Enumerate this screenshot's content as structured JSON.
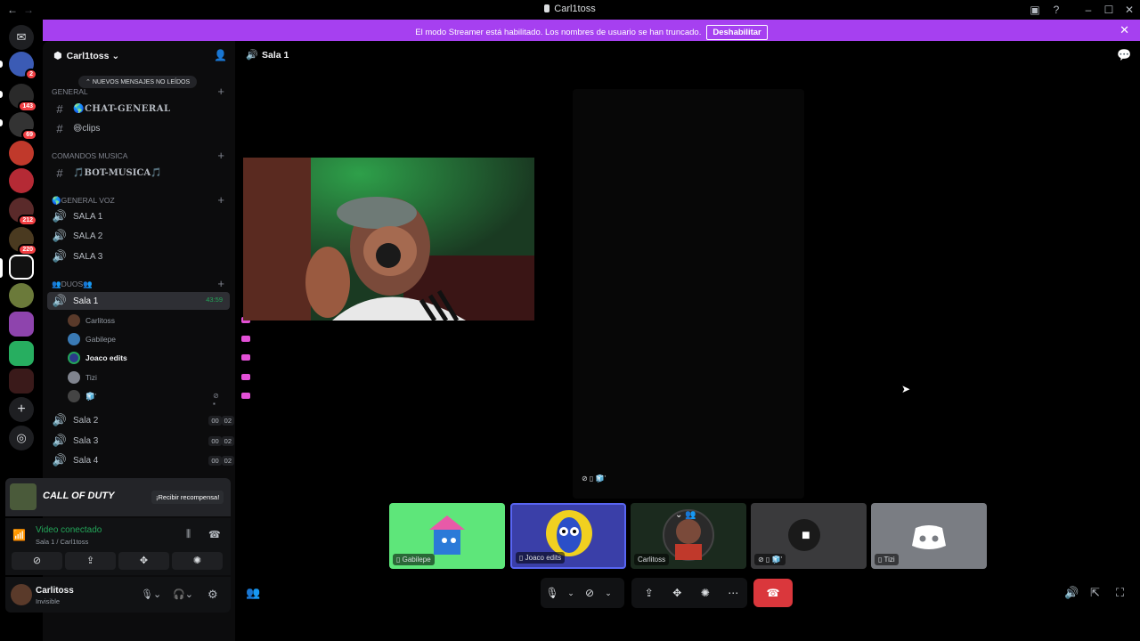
{
  "window": {
    "title": "Carl1toss"
  },
  "banner": {
    "text": "El modo Streamer está habilitado. Los nombres de usuario se han truncado.",
    "button": "Deshabilitar",
    "color": "#a640f0"
  },
  "rail": {
    "badges": [
      "2",
      "143",
      "69",
      "212",
      "220"
    ]
  },
  "sidebar": {
    "guild_name": "Carl1toss",
    "unread_pill": "NUEVOS MENSAJES NO LEÍDOS",
    "cat_general": "GENERAL",
    "ch_chat": "🌎CHAT-GENERAL",
    "ch_clips": "😄clips",
    "cat_musica": "COMANDOS MUSICA",
    "ch_bot": "🎵BOT-MUSICA🎵",
    "cat_voz": "🌎GENERAL VOZ",
    "voz": [
      "SALA 1",
      "SALA 2",
      "SALA 3"
    ],
    "cat_duos": "👥DUOS👥",
    "active_channel": "Sala 1",
    "active_timer": "43:59",
    "members": [
      "Carlitoss",
      "Gabilepe",
      "Joaco edits",
      "Tizi",
      "🧊'"
    ],
    "other_rooms": [
      {
        "name": "Sala 2",
        "a": "00",
        "b": "02"
      },
      {
        "name": "Sala 3",
        "a": "00",
        "b": "02"
      },
      {
        "name": "Sala 4",
        "a": "00",
        "b": "02"
      }
    ]
  },
  "promo": {
    "brand": "CALL OF DUTY",
    "cta": "¡Recibir recompensa!"
  },
  "voice": {
    "status": "Video conectado",
    "location": "Sala 1 / Carl1toss",
    "status_color": "#23a559"
  },
  "user": {
    "name": "Carlitoss",
    "status": "Invisible"
  },
  "call": {
    "channel": "Sala 1",
    "tiles": [
      {
        "label": "Gabilepe"
      },
      {
        "label": "Joaco edits"
      },
      {
        "label": "Carlitoss"
      },
      {
        "label": ""
      },
      {
        "label": "Tizi"
      }
    ],
    "focus_label": "🧊'"
  },
  "colors": {
    "accent": "#5865f2",
    "danger": "#da373c",
    "live": "#e250d6"
  }
}
